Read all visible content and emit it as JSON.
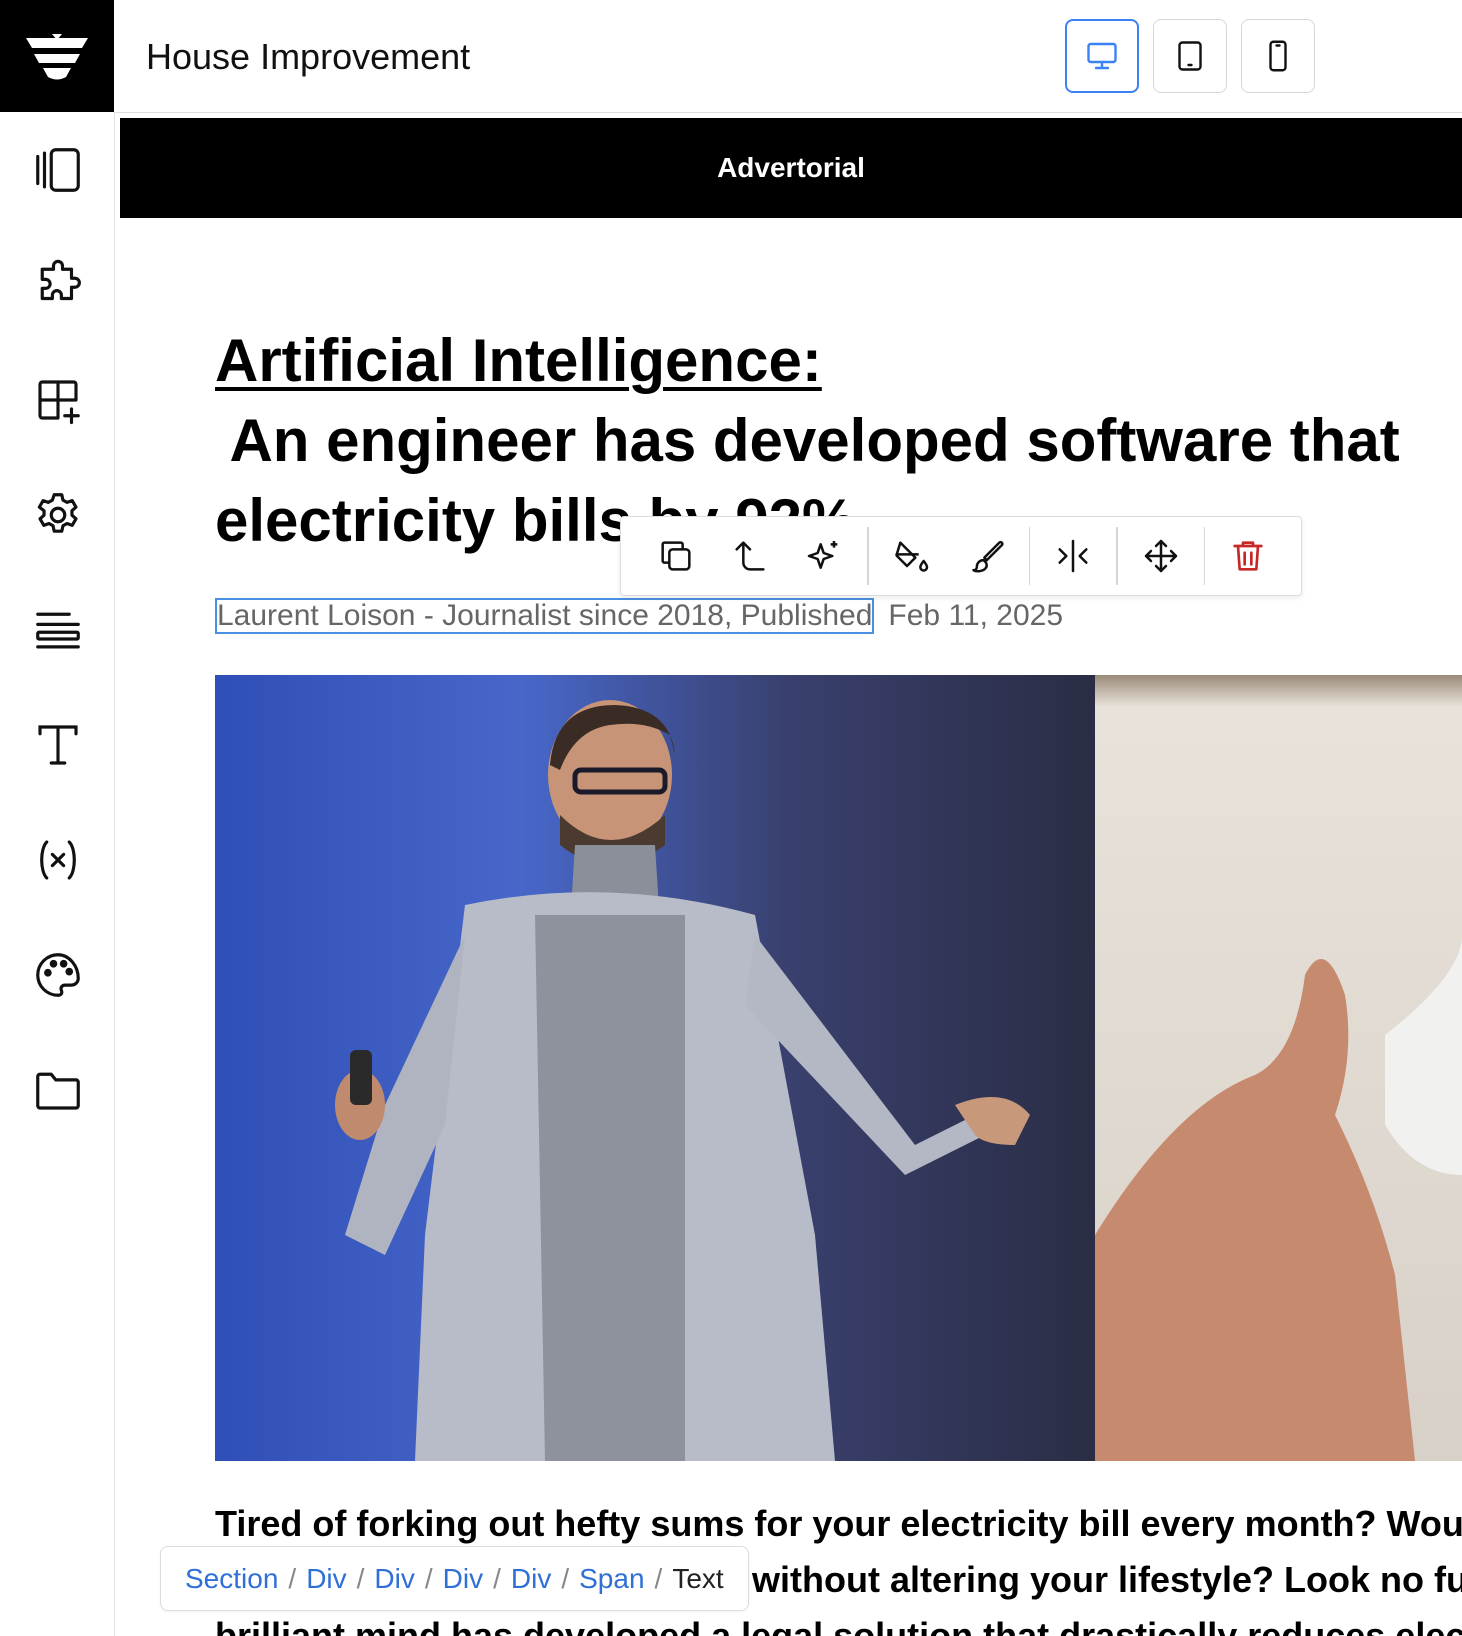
{
  "app": {
    "title": "House Improvement"
  },
  "devices": [
    {
      "label": "desktop",
      "active": true
    },
    {
      "label": "tablet",
      "active": false
    },
    {
      "label": "mobile",
      "active": false
    }
  ],
  "sidebar": {
    "items": [
      "layers-icon",
      "puzzle-icon",
      "add-block-icon",
      "settings-icon",
      "align-icon",
      "text-icon",
      "variable-icon",
      "palette-icon",
      "folder-icon"
    ]
  },
  "page": {
    "banner": "Advertorial",
    "headline": {
      "line1": "Artificial Intelligence:",
      "line2": " An engineer has developed software that",
      "line3": "electricity bills by 92%"
    },
    "byline": {
      "selected_text": "Laurent Loison - Journalist since 2018, Published",
      "date": "Feb 11, 2025"
    },
    "body": {
      "line1": "Tired of forking out hefty sums for your electricity bill every month? Would",
      "line2": "it without altering your lifestyle? Look no further",
      "line3": "brilliant mind has developed a legal solution that drastically reduces elect"
    }
  },
  "element_toolbar": {
    "tools": [
      "copy-icon",
      "select-parent-icon",
      "ai-sparkle-icon",
      "fill-icon",
      "brush-icon",
      "flip-icon",
      "move-icon",
      "delete-icon"
    ],
    "danger_color": "#c62828"
  },
  "breadcrumb": {
    "items": [
      "Section",
      "Div",
      "Div",
      "Div",
      "Div",
      "Span"
    ],
    "current": "Text"
  },
  "colors": {
    "accent": "#3b82f6",
    "link": "#2f6fd6",
    "selection": "#4a90e2"
  }
}
